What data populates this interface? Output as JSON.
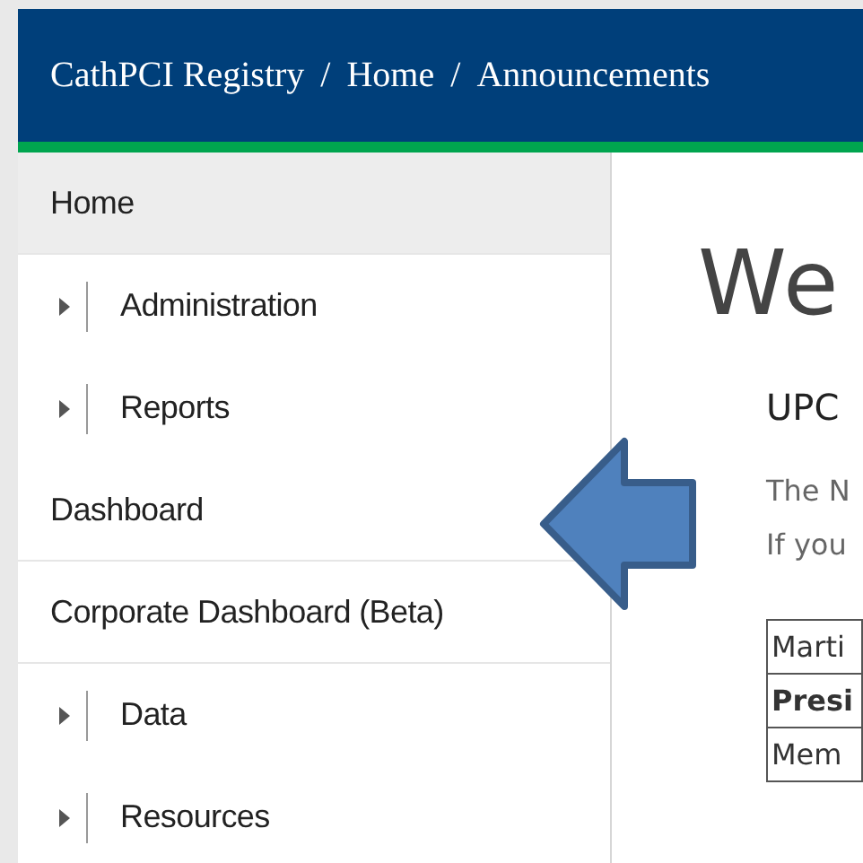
{
  "header": {
    "breadcrumb": [
      {
        "label": "CathPCI Registry"
      },
      {
        "label": "Home"
      },
      {
        "label": "Announcements"
      }
    ],
    "separator": "/"
  },
  "sidebar": {
    "items": [
      {
        "label": "Home",
        "kind": "link",
        "selected": true
      },
      {
        "label": "Administration",
        "kind": "group",
        "selected": false,
        "expanded": false
      },
      {
        "label": "Reports",
        "kind": "group",
        "selected": false,
        "expanded": false
      },
      {
        "label": "Dashboard",
        "kind": "link",
        "selected": false
      },
      {
        "label": "Corporate Dashboard (Beta)",
        "kind": "link",
        "selected": false
      },
      {
        "label": "Data",
        "kind": "group",
        "selected": false,
        "expanded": false
      },
      {
        "label": "Resources",
        "kind": "group",
        "selected": false,
        "expanded": false
      }
    ]
  },
  "content": {
    "heading": "We",
    "subheading": "UPC",
    "paragraph_lines": [
      "The N",
      "If you"
    ],
    "table": {
      "rows": [
        {
          "cell": "Marti",
          "bold": false
        },
        {
          "cell": "Presi",
          "bold": true
        },
        {
          "cell": "Mem",
          "bold": false
        }
      ]
    }
  },
  "annotation": {
    "kind": "arrow"
  }
}
